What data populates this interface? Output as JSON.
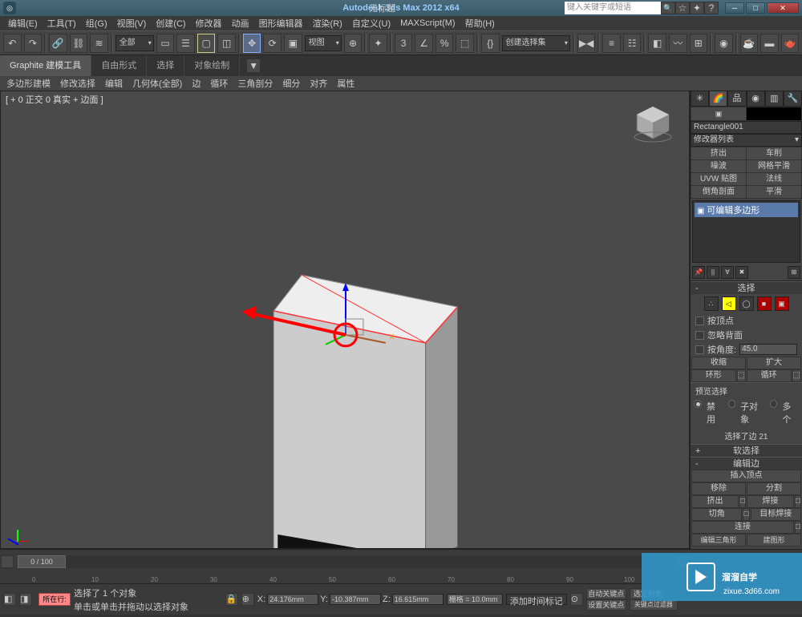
{
  "titlebar": {
    "app_title": "Autodesk 3ds Max 2012 x64",
    "doc_title": "无标题",
    "search_placeholder": "键入关键字或短语",
    "min": "─",
    "max": "□",
    "close": "✕"
  },
  "menu": [
    "编辑(E)",
    "工具(T)",
    "组(G)",
    "视图(V)",
    "创建(C)",
    "修改器",
    "动画",
    "图形编辑器",
    "渲染(R)",
    "自定义(U)",
    "MAXScript(M)",
    "帮助(H)"
  ],
  "toolbar": {
    "all_drop": "全部",
    "view_drop": "视图",
    "selset_drop": "创建选择集"
  },
  "ribbon_tabs": [
    "Graphite 建模工具",
    "自由形式",
    "选择",
    "对象绘制"
  ],
  "polybar": [
    "多边形建模",
    "修改选择",
    "编辑",
    "几何体(全部)",
    "边",
    "循环",
    "三角剖分",
    "细分",
    "对齐",
    "属性"
  ],
  "viewport_label": "[ + 0 正交 0 真实 + 边面 ]",
  "cmdpanel": {
    "obj_name": "Rectangle001",
    "mod_list": "修改器列表",
    "mod_buttons": [
      "挤出",
      "车削",
      "噪波",
      "网格平滑",
      "UVW 贴图",
      "法线",
      "倒角剖面",
      "平滑"
    ],
    "mod_item": "可编辑多边形",
    "selection_title": "选择",
    "by_vertex": "按顶点",
    "ignore_back": "忽略背面",
    "by_angle": "按角度:",
    "angle_val": "45.0",
    "shrink": "收缩",
    "grow": "扩大",
    "ring": "环形",
    "loop": "循环",
    "preview_sel": "预览选择",
    "radio_off": "禁用",
    "radio_sub": "子对象",
    "radio_multi": "多个",
    "sel_status": "选择了边 21",
    "soft_sel": "软选择",
    "edit_edges": "编辑边",
    "insert_vert": "插入顶点",
    "remove": "移除",
    "split": "分割",
    "extrude": "挤出",
    "weld": "焊接",
    "chamfer": "切角",
    "target_weld": "目标焊接",
    "connect": "连接",
    "edit_tri": "编辑三角形",
    "create_shape": "建图形"
  },
  "timeslider": {
    "pos": "0 / 100"
  },
  "ticks": [
    "0",
    "10",
    "20",
    "30",
    "40",
    "50",
    "60",
    "70",
    "80",
    "90",
    "100"
  ],
  "status": {
    "obj_sel": "选择了 1 个对象",
    "click_hint": "单击或单击并拖动以选择对象",
    "x": "X:",
    "xv": "24.176mm",
    "y": "Y:",
    "yv": "-10.387mm",
    "z": "Z:",
    "zv": "16.615mm",
    "grid": "栅格 = 10.0mm",
    "auto_key": "自动关键点",
    "set_key": "设置关键点",
    "selset": "选定对象",
    "filter": "关键点过滤器",
    "row_label": "所在行:",
    "add_marker": "添加时间标记"
  },
  "watermark": {
    "text": "溜溜自学",
    "url": "zixue.3d66.com"
  }
}
